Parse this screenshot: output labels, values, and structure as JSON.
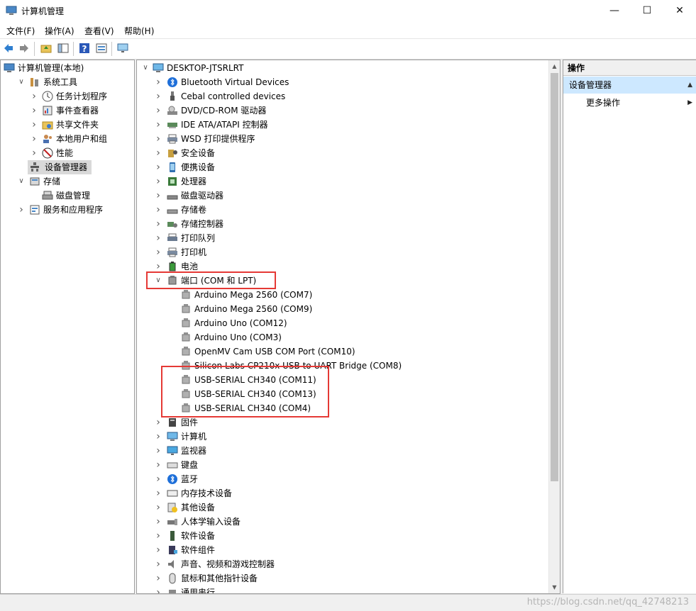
{
  "window": {
    "title": "计算机管理",
    "minimize": "—",
    "maximize": "☐",
    "close": "✕"
  },
  "menu": [
    "文件(F)",
    "操作(A)",
    "查看(V)",
    "帮助(H)"
  ],
  "toolbar": {
    "icons": [
      "back-arrow-icon",
      "forward-arrow-icon",
      "up-folder-icon",
      "show-hide-tree-icon",
      "help-icon",
      "properties-icon",
      "monitor-icon"
    ]
  },
  "left_tree": [
    {
      "label": "计算机管理(本地)",
      "level": 0,
      "expand": "none",
      "icon": "computer-management-icon"
    },
    {
      "label": "系统工具",
      "level": 1,
      "expand": "open",
      "icon": "tools-icon"
    },
    {
      "label": "任务计划程序",
      "level": 2,
      "expand": "closed",
      "icon": "clock-icon"
    },
    {
      "label": "事件查看器",
      "level": 2,
      "expand": "closed",
      "icon": "event-viewer-icon"
    },
    {
      "label": "共享文件夹",
      "level": 2,
      "expand": "closed",
      "icon": "shared-folder-icon"
    },
    {
      "label": "本地用户和组",
      "level": 2,
      "expand": "closed",
      "icon": "users-icon"
    },
    {
      "label": "性能",
      "level": 2,
      "expand": "closed",
      "icon": "performance-icon"
    },
    {
      "label": "设备管理器",
      "level": 2,
      "expand": "none",
      "icon": "device-manager-icon",
      "selected": true
    },
    {
      "label": "存储",
      "level": 1,
      "expand": "open",
      "icon": "storage-icon"
    },
    {
      "label": "磁盘管理",
      "level": 2,
      "expand": "none",
      "icon": "disk-management-icon"
    },
    {
      "label": "服务和应用程序",
      "level": 1,
      "expand": "closed",
      "icon": "services-icon"
    }
  ],
  "device_tree": {
    "root": {
      "label": "DESKTOP-JTSRLRT",
      "icon": "computer-icon"
    },
    "categories_before": [
      {
        "label": "Bluetooth Virtual Devices",
        "icon": "bluetooth-icon"
      },
      {
        "label": "Cebal controlled devices",
        "icon": "usb-plug-icon"
      },
      {
        "label": "DVD/CD-ROM 驱动器",
        "icon": "dvd-drive-icon"
      },
      {
        "label": "IDE ATA/ATAPI 控制器",
        "icon": "ide-controller-icon"
      },
      {
        "label": "WSD 打印提供程序",
        "icon": "printer-icon"
      },
      {
        "label": "安全设备",
        "icon": "security-device-icon"
      },
      {
        "label": "便携设备",
        "icon": "portable-device-icon"
      },
      {
        "label": "处理器",
        "icon": "processor-icon"
      },
      {
        "label": "磁盘驱动器",
        "icon": "disk-drive-icon"
      },
      {
        "label": "存储卷",
        "icon": "storage-volume-icon"
      },
      {
        "label": "存储控制器",
        "icon": "storage-controller-icon"
      },
      {
        "label": "打印队列",
        "icon": "print-queue-icon"
      },
      {
        "label": "打印机",
        "icon": "printer-icon"
      },
      {
        "label": "电池",
        "icon": "battery-icon"
      }
    ],
    "ports": {
      "label": "端口 (COM 和 LPT)",
      "icon": "port-icon",
      "children": [
        "Arduino Mega 2560 (COM7)",
        "Arduino Mega 2560 (COM9)",
        "Arduino Uno (COM12)",
        "Arduino Uno (COM3)",
        "OpenMV Cam USB COM Port (COM10)",
        "Silicon Labs CP210x USB to UART Bridge (COM8)",
        "USB-SERIAL CH340 (COM11)",
        "USB-SERIAL CH340 (COM13)",
        "USB-SERIAL CH340 (COM4)"
      ]
    },
    "categories_after": [
      {
        "label": "固件",
        "icon": "firmware-icon"
      },
      {
        "label": "计算机",
        "icon": "computer-icon"
      },
      {
        "label": "监视器",
        "icon": "monitor-icon"
      },
      {
        "label": "键盘",
        "icon": "keyboard-icon"
      },
      {
        "label": "蓝牙",
        "icon": "bluetooth-icon"
      },
      {
        "label": "内存技术设备",
        "icon": "memory-device-icon"
      },
      {
        "label": "其他设备",
        "icon": "unknown-device-icon"
      },
      {
        "label": "人体学输入设备",
        "icon": "hid-icon"
      },
      {
        "label": "软件设备",
        "icon": "software-device-icon"
      },
      {
        "label": "软件组件",
        "icon": "software-component-icon"
      },
      {
        "label": "声音、视频和游戏控制器",
        "icon": "sound-icon"
      },
      {
        "label": "鼠标和其他指针设备",
        "icon": "mouse-icon"
      },
      {
        "label": "通用串行",
        "icon": "usb-controller-icon"
      }
    ]
  },
  "actions": {
    "header": "操作",
    "group": "设备管理器",
    "group_arrow": "▲",
    "item": "更多操作",
    "item_arrow": "▶"
  },
  "watermark": "https://blog.csdn.net/qq_42748213",
  "colors": {
    "selection": "#d9d9d9",
    "action_group": "#cde8ff",
    "highlight_box": "#e53935"
  }
}
